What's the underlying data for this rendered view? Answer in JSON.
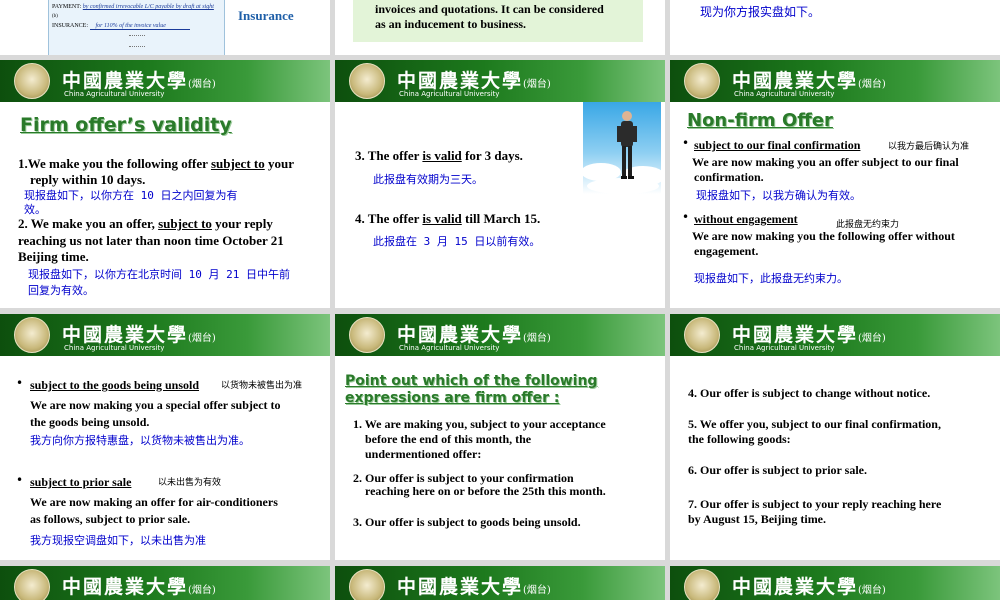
{
  "header": {
    "title": "中國農業大學",
    "campus": "(烟台)",
    "subtitle": "China Agricultural University"
  },
  "top_row": {
    "left": {
      "payment_label": "PAYMENT:",
      "payment_value": "by confirmed irrevocable L/C payable by draft at sight",
      "small_note": "(b)",
      "insurance_label": "INSURANCE:",
      "insurance_value": "for 110% of the invoice value",
      "side_word": "Insurance"
    },
    "middle": {
      "line1": "invoices and quotations. It can be considered",
      "line2": "as an inducement to business."
    },
    "right": {
      "cn": "现为你方报实盘如下。"
    }
  },
  "slide_validity": {
    "heading": "Firm offer’s validity",
    "item1_pre": "1.We make you the following  offer ",
    "item1_u": "subject to",
    "item1_post": " your",
    "item1_line2": "reply within 10 days.",
    "item1_cn1": "现报盘如下，以你方在 10 日之内回复为有",
    "item1_cn2": "效。",
    "item2_pre": "2. We make you an offer, ",
    "item2_u": "subject to",
    "item2_post": " your reply",
    "item2_line2": "reaching us not later than noon time October 21",
    "item2_line3": "Beijing time.",
    "item2_cn1": "现报盘如下，以你方在北京时间 10 月 21 日中午前",
    "item2_cn2": "回复为有效。"
  },
  "slide_valid": {
    "item3_pre": "3. The offer ",
    "item3_u": "is valid",
    "item3_post": " for 3 days.",
    "item3_cn": "此报盘有效期为三天。",
    "item4_pre": "4. The offer ",
    "item4_u": "is valid",
    "item4_post": " till March 15.",
    "item4_cn": "此报盘在 3 月 15 日以前有效。"
  },
  "slide_nonfirm": {
    "heading": "Non-firm Offer",
    "b1_term": "subject to our final confirmation",
    "b1_note": "以我方最后确认为准",
    "b1_line1": "We are now making you an offer subject to our final",
    "b1_line2": "confirmation.",
    "b1_cn": "现报盘如下，以我方确认为有效。",
    "b2_term": "without engagement",
    "b2_note": "此报盘无约束力",
    "b2_line1": "We are now making you the following offer without",
    "b2_line2": "engagement.",
    "b2_cn": "现报盘如下，此报盘无约束力。"
  },
  "slide_unsold": {
    "b1_term": "subject to the goods being unsold",
    "b1_note": "以货物未被售出为准",
    "b1_line1": "We are now making you a special offer subject to",
    "b1_line2": "the goods being unsold.",
    "b1_cn": "我方向你方报特惠盘，以货物未被售出为准。",
    "b2_term": "subject to prior sale",
    "b2_note": "以未出售为有效",
    "b2_line1": "We are now making an offer for air-conditioners",
    "b2_line2": "as follows, subject to prior sale.",
    "b2_cn": "我方现报空调盘如下，以未出售为准"
  },
  "slide_pointout": {
    "heading1": "Point out which of the following",
    "heading2": "expressions are firm offer :",
    "q1_l1": "1. We are making you, subject to your acceptance",
    "q1_l2": "before the end of this month, the",
    "q1_l3": "undermentioned offer:",
    "q2_l1": "2. Our offer is subject to your confirmation",
    "q2_l2": "reaching here on or before  the 25th this month.",
    "q3": "3. Our offer is subject to goods being unsold."
  },
  "slide_more": {
    "q4": "4. Our offer is subject to change without notice.",
    "q5_l1": "5. We offer you, subject to our final confirmation,",
    "q5_l2": "the following goods:",
    "q6": "6. Our offer is subject to prior sale.",
    "q7_l1": "7. Our offer is subject to your reply reaching here",
    "q7_l2": "by August 15, Beijing time."
  },
  "colors": {
    "header_green": "#1d7a1d",
    "heading_green": "#2a7a2a",
    "chinese_blue": "#0000cc"
  },
  "icons": [
    "university-seal-logo",
    "businessman-on-clouds-image"
  ]
}
